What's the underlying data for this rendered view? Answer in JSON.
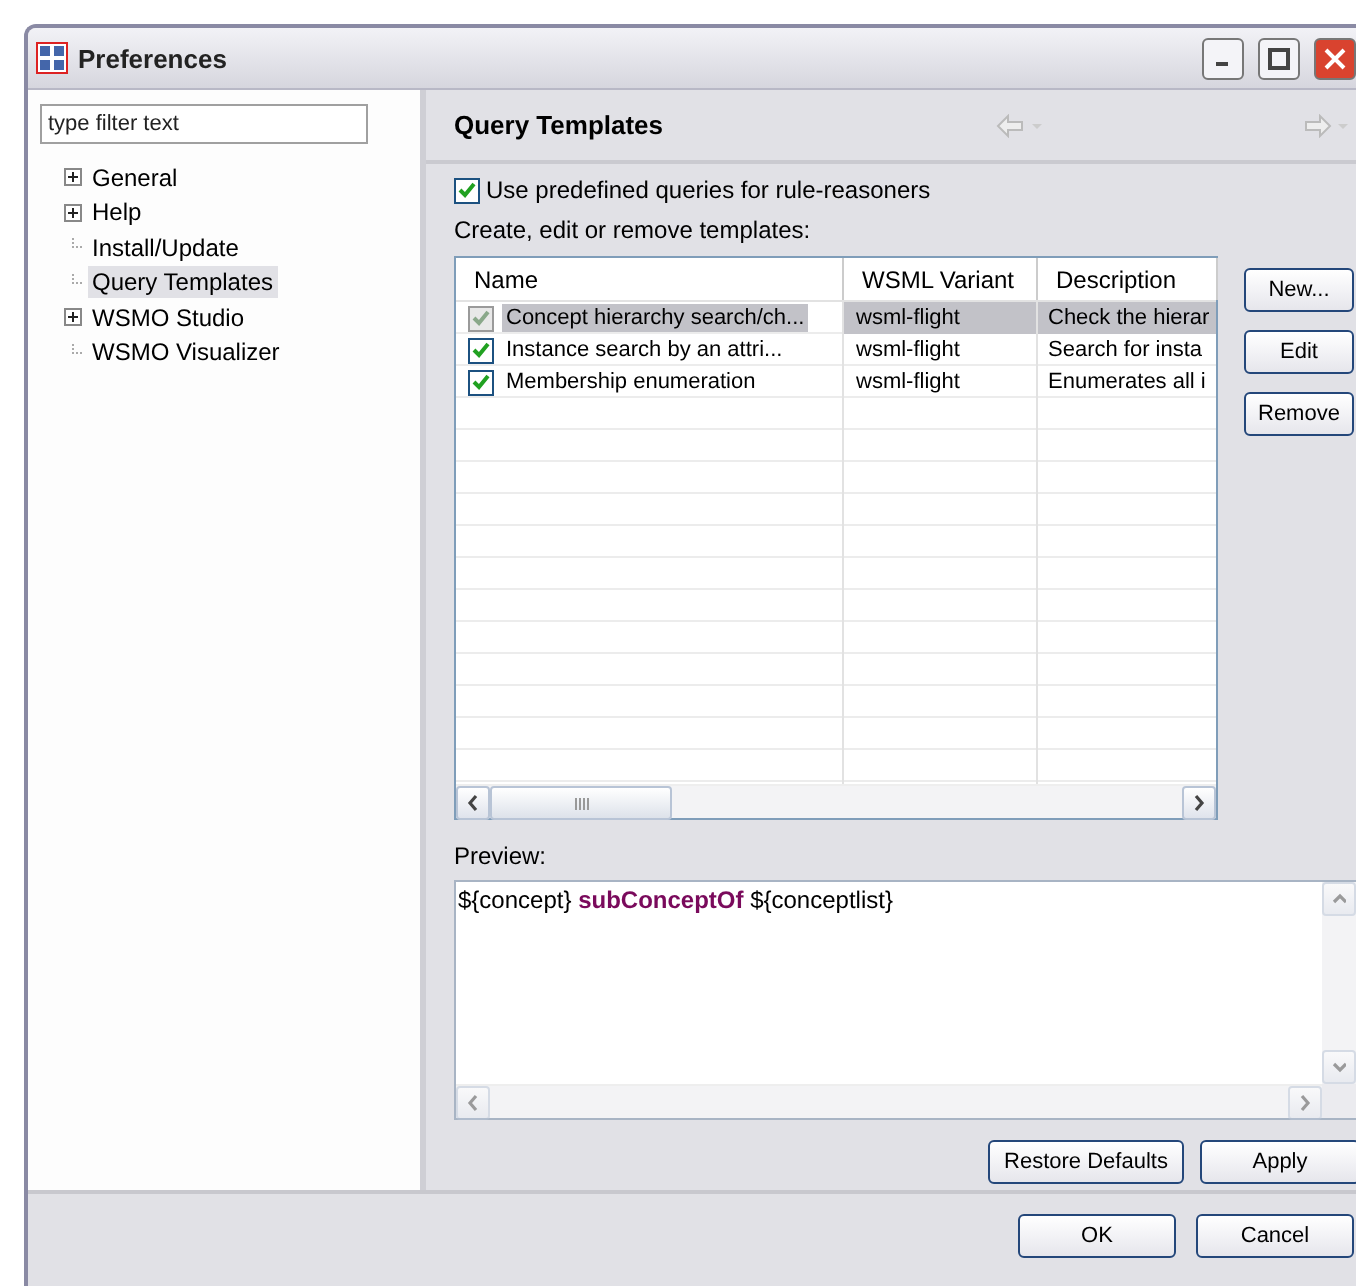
{
  "window": {
    "title": "Preferences"
  },
  "filter": {
    "placeholder": "type filter text"
  },
  "tree": [
    {
      "label": "General",
      "expanded": false,
      "selected": false
    },
    {
      "label": "Help",
      "expanded": false,
      "selected": false
    },
    {
      "label": "Install/Update",
      "selected": false
    },
    {
      "label": "Query Templates",
      "selected": true
    },
    {
      "label": "WSMO Studio",
      "expanded": false,
      "selected": false
    },
    {
      "label": "WSMO Visualizer",
      "selected": false
    }
  ],
  "page": {
    "title": "Query Templates",
    "use_predefined": {
      "label": "Use predefined queries for rule-reasoners",
      "checked": true
    },
    "table_label": "Create, edit or remove templates:",
    "table": {
      "columns": [
        "Name",
        "WSML Variant",
        "Description"
      ],
      "rows": [
        {
          "name": "Concept hierarchy search/ch...",
          "variant": "wsml-flight",
          "description": "Check the hierar",
          "checked": true,
          "selected": true
        },
        {
          "name": "Instance search  by an attri...",
          "variant": "wsml-flight",
          "description": "Search for insta",
          "checked": true,
          "selected": false
        },
        {
          "name": "Membership enumeration",
          "variant": "wsml-flight",
          "description": "Enumerates all i",
          "checked": true,
          "selected": false
        }
      ]
    },
    "side_buttons": [
      "New...",
      "Edit",
      "Remove"
    ],
    "preview_label": "Preview:",
    "preview": "${concept} **subConceptOf** ${conceptlist}",
    "page_buttons": [
      "Restore Defaults",
      "Apply"
    ]
  },
  "dialog_buttons": [
    "OK",
    "Cancel"
  ]
}
